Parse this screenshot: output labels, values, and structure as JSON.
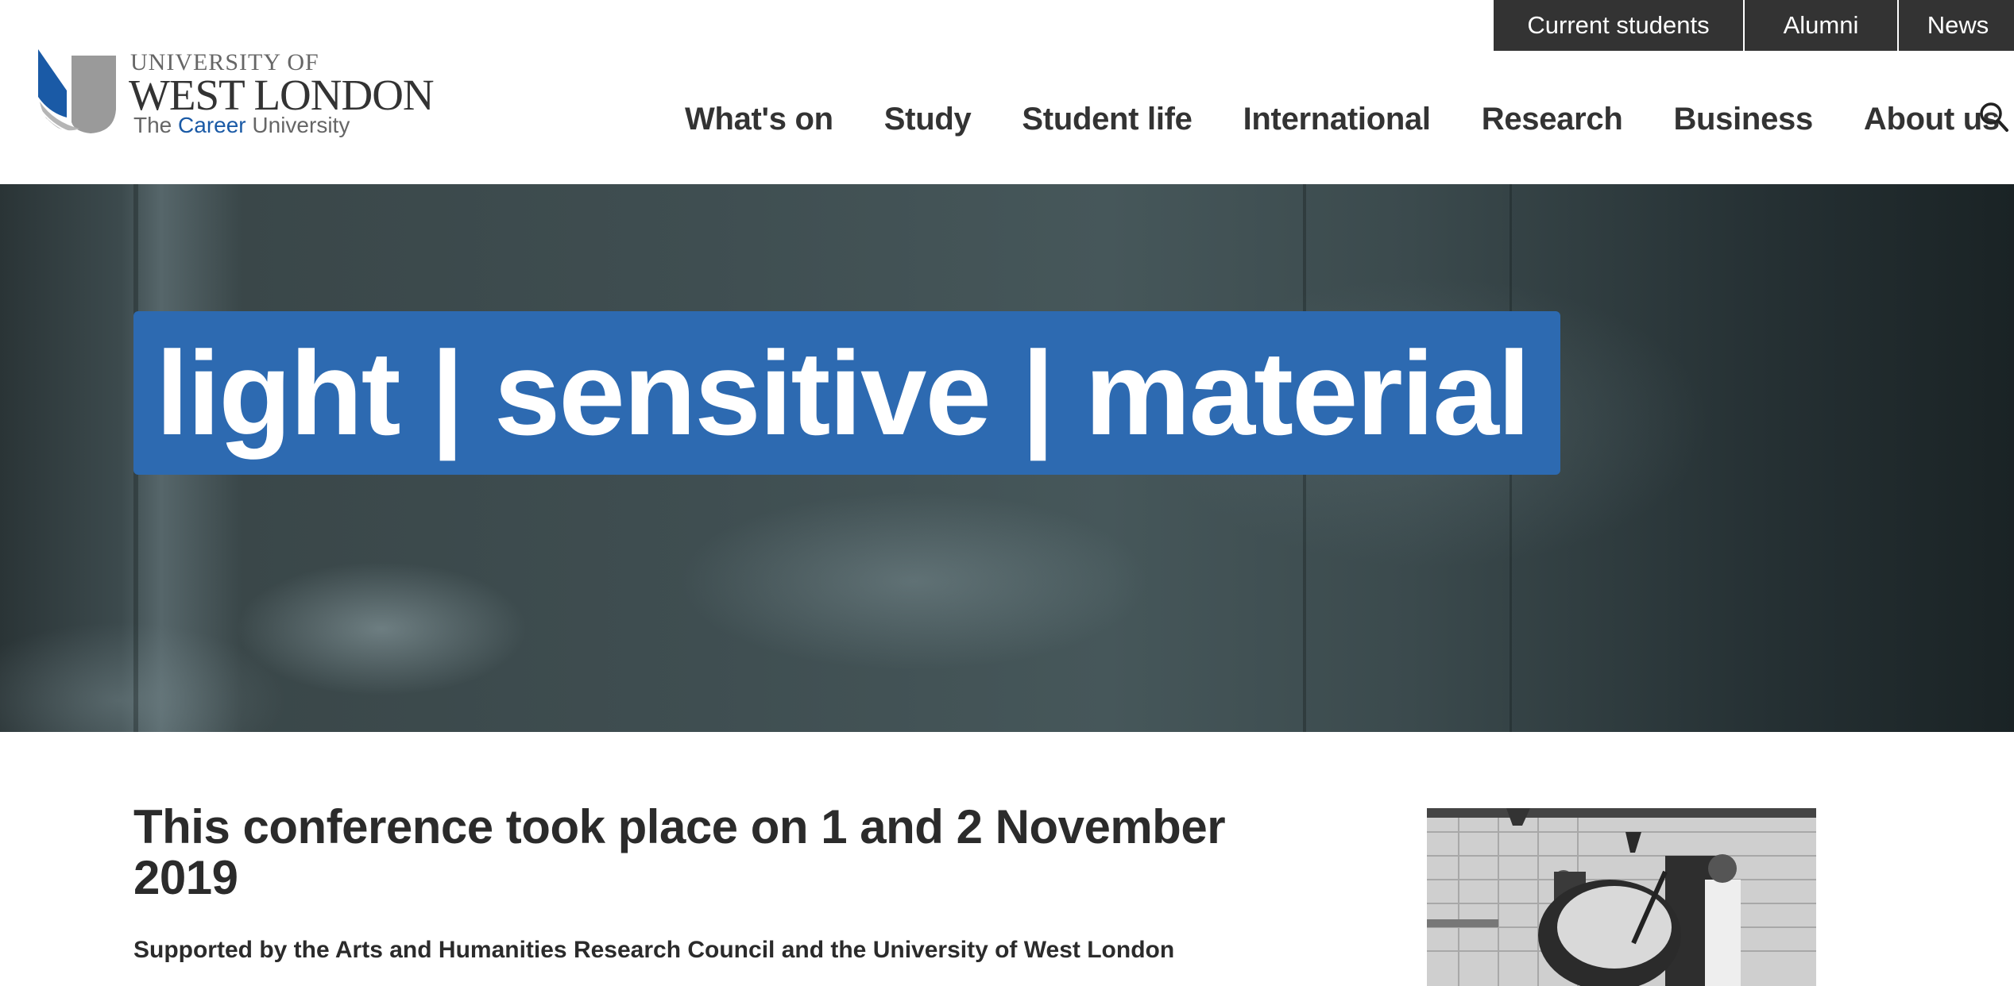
{
  "utility_nav": {
    "items": [
      {
        "label": "Current students"
      },
      {
        "label": "Alumni"
      },
      {
        "label": "News"
      }
    ]
  },
  "logo": {
    "line1": "UNIVERSITY OF",
    "line2": "WEST LONDON",
    "tagline_pre": "The ",
    "tagline_accent": "Career",
    "tagline_post": " University"
  },
  "main_nav": {
    "items": [
      {
        "label": "What's on"
      },
      {
        "label": "Study"
      },
      {
        "label": "Student life"
      },
      {
        "label": "International"
      },
      {
        "label": "Research"
      },
      {
        "label": "Business"
      },
      {
        "label": "About us"
      }
    ],
    "search_icon": "search-icon"
  },
  "hero": {
    "title": "light | sensitive | material"
  },
  "content": {
    "heading": "This conference took place on 1 and 2 November 2019",
    "subheading": "Supported by the Arts and Humanities Research Council and the University of West London"
  },
  "colors": {
    "brand_blue": "#2d6ab1",
    "utility_bar": "#333333",
    "text_dark": "#2b2b2b"
  }
}
